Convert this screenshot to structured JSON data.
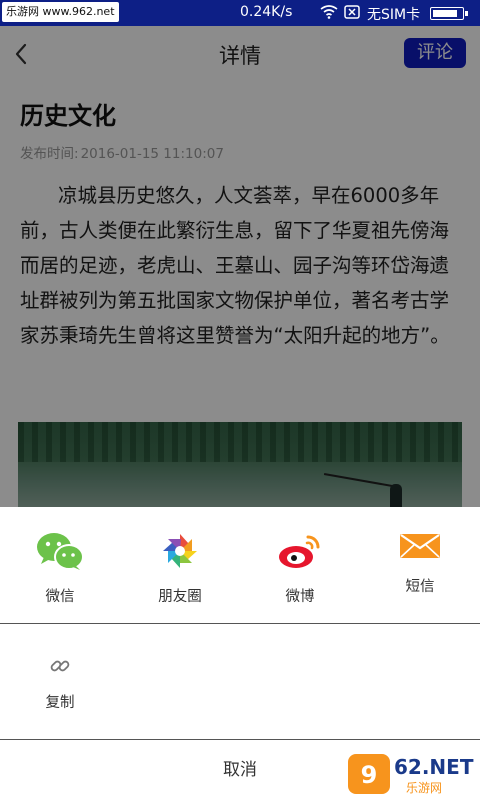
{
  "status_bar": {
    "watermark": "乐游网 www.962.net",
    "speed": "0.24K/s",
    "carrier": "无SIM卡",
    "battery_level": 0.9
  },
  "header": {
    "title": "详情",
    "comment_label": "评论"
  },
  "article": {
    "title": "历史文化",
    "meta_label": "发布时间:",
    "published": "2016-01-15 11:10:07",
    "body": "凉城县历史悠久，人文荟萃，早在6000多年前，古人类便在此繁衍生息，留下了华夏祖先傍海而居的足迹，老虎山、王墓山、园子沟等环岱海遗址群被列为第五批国家文物保护单位，著名考古学家苏秉琦先生曾将这里赞誉为“太阳升起的地方”。"
  },
  "share_sheet": {
    "items": [
      {
        "label": "微信",
        "icon": "wechat-icon"
      },
      {
        "label": "朋友圈",
        "icon": "moments-icon"
      },
      {
        "label": "微博",
        "icon": "weibo-icon"
      },
      {
        "label": "短信",
        "icon": "sms-icon"
      }
    ],
    "copy_label": "复制",
    "cancel_label": "取消"
  },
  "corner_logo": {
    "text": "962.NET",
    "sub": "乐游网"
  },
  "colors": {
    "accent": "#0f1cc0",
    "status_bar": "#0d1f86",
    "wechat": "#6cc24a",
    "weibo": "#e6162d",
    "sms": "#f7941d"
  }
}
